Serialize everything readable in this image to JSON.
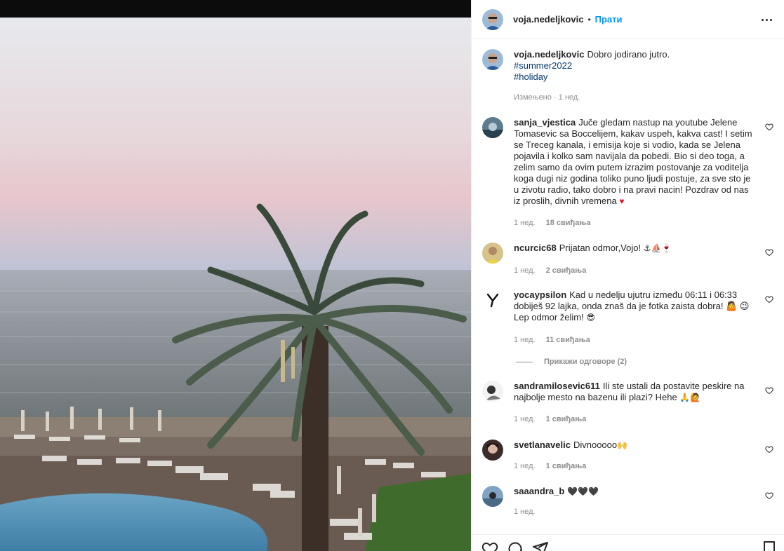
{
  "post": {
    "username": "voja.nedeljkovic",
    "follow_label": "Прати",
    "separator": "•",
    "caption_text": "Dobro jodirano jutro.",
    "hashtags": [
      "#summer2022",
      "#holiday"
    ],
    "caption_meta": "Измењено · 1 нед."
  },
  "comments": [
    {
      "author": "sanja_vjestica",
      "text": "Juče gledam nastup na youtube Jelene Tomasevic sa Boccelijem, kakav uspeh, kakva cast! I setim se Treceg kanala, i emisija koje si vodio, kada se Jelena pojavila i kolko sam navijala da pobedi. Bio si deo toga, a zelim samo da ovim putem izrazim postovanje za voditelja koga dugi niz godina toliko puno ljudi postuje, za sve sto je u zivotu radio, tako dobro i na pravi nacin! Pozdrav od nas iz proslih, divnih vremena",
      "emoji": "♥",
      "time": "1 нед.",
      "likes": "18 свиђања"
    },
    {
      "author": "ncurcic68",
      "text": "Prijatan odmor,Vojo!",
      "emoji": "⚓⛵🍷",
      "time": "1 нед.",
      "likes": "2 свиђања"
    },
    {
      "author": "yocaypsilon",
      "text": "Kad u nedelju ujutru između 06:11 i 06:33 dobiješ 92 lajka, onda znaš da je fotka zaista dobra! 🤷 😉 Lep odmor želim!",
      "emoji": "😎",
      "time": "1 нед.",
      "likes": "11 свиђања",
      "replies": "Прикажи одговоре (2)"
    },
    {
      "author": "sandramilosevic611",
      "text": "Ili ste ustali da postavite peskire na najbolje mesto na bazenu ili plazi? Hehe",
      "emoji": "🙏🙋",
      "time": "1 нед.",
      "likes": "1 свиђања"
    },
    {
      "author": "svetlanavelic",
      "text": "Divnooooo",
      "emoji": "🙌",
      "time": "1 нед.",
      "likes": "1 свиђања"
    },
    {
      "author": "saaandra_b",
      "text": "",
      "emoji": "🖤🖤🖤",
      "time": "1 нед.",
      "likes": ""
    }
  ],
  "icons": {
    "more": "more-options-icon",
    "like": "heart-icon",
    "comment": "comment-icon",
    "share": "share-icon",
    "save": "bookmark-icon"
  },
  "colors": {
    "link": "#0095f6",
    "hashtag": "#00376b",
    "muted": "#8e8e8e",
    "text": "#262626"
  }
}
